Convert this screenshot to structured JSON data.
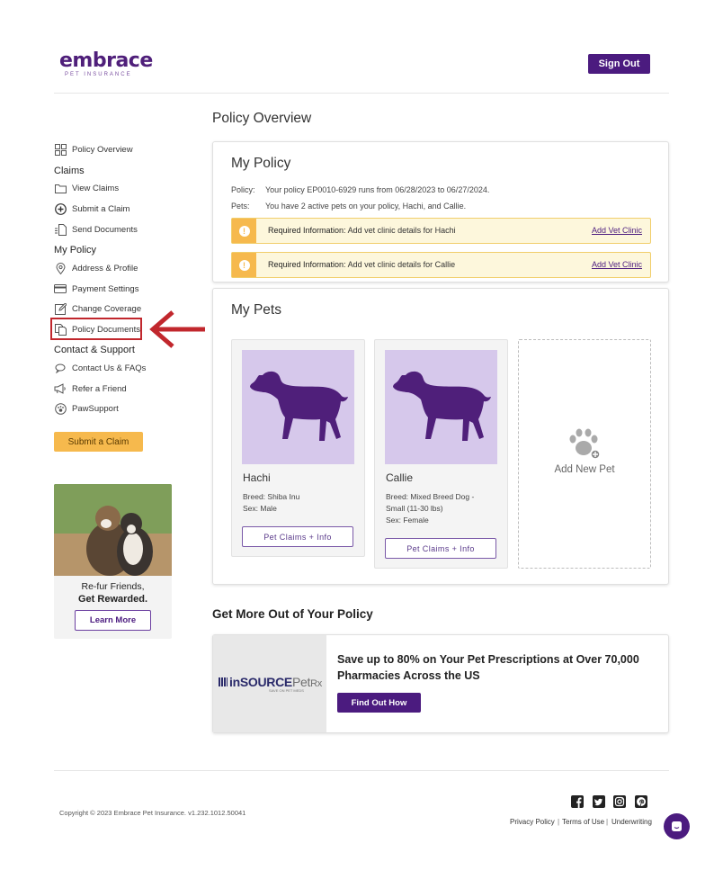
{
  "header": {
    "logo_word": "embrace",
    "logo_sub": "PET INSURANCE",
    "sign_out_label": "Sign Out"
  },
  "sidebar": {
    "overview_label": "Policy Overview",
    "claims_heading": "Claims",
    "claims_items": [
      {
        "label": "View Claims",
        "icon": "folder-icon"
      },
      {
        "label": "Submit a Claim",
        "icon": "plus-circle-icon"
      },
      {
        "label": "Send Documents",
        "icon": "document-upload-icon"
      }
    ],
    "policy_heading": "My Policy",
    "policy_items": [
      {
        "label": "Address & Profile",
        "icon": "location-pin-icon"
      },
      {
        "label": "Payment Settings",
        "icon": "credit-card-icon"
      },
      {
        "label": "Change Coverage",
        "icon": "edit-icon"
      },
      {
        "label": "Policy Documents",
        "icon": "documents-icon"
      }
    ],
    "support_heading": "Contact & Support",
    "support_items": [
      {
        "label": "Contact Us & FAQs",
        "icon": "chat-icon"
      },
      {
        "label": "Refer a Friend",
        "icon": "megaphone-icon"
      },
      {
        "label": "PawSupport",
        "icon": "paw-circle-icon"
      }
    ],
    "submit_claim_label": "Submit a Claim",
    "promo": {
      "line1": "Re-fur Friends,",
      "line2": "Get Rewarded.",
      "button": "Learn More"
    }
  },
  "main": {
    "page_title": "Policy Overview",
    "policy": {
      "title": "My Policy",
      "policy_key": "Policy:",
      "policy_value": "Your policy EP0010-6929 runs from 06/28/2023 to 06/27/2024.",
      "pets_key": "Pets:",
      "pets_value": "You have 2 active pets on your policy, Hachi, and Callie.",
      "alerts": [
        {
          "label": "Required Information:",
          "text": "Add vet clinic details for Hachi",
          "link": "Add Vet Clinic"
        },
        {
          "label": "Required Information:",
          "text": "Add vet clinic details for Callie",
          "link": "Add Vet Clinic"
        }
      ]
    },
    "pets": {
      "title": "My Pets",
      "items": [
        {
          "name": "Hachi",
          "breed": "Breed:  Shiba Inu",
          "sex": "Sex:  Male",
          "button": "Pet Claims + Info"
        },
        {
          "name": "Callie",
          "breed1": "Breed:  Mixed Breed Dog -",
          "breed2": "Small (11-30 lbs)",
          "sex": "Sex:  Female",
          "button": "Pet Claims + Info"
        }
      ],
      "add_new": "Add New Pet"
    },
    "more": {
      "title": "Get More Out of Your Policy",
      "logo_main": "inSOURCE",
      "logo_pet": "Pet",
      "logo_rx": "Rx",
      "logo_sub": "SAVE ON PET MEDS",
      "text": "Save up to 80% on Your Pet Prescriptions at Over 70,000 Pharmacies Across the US",
      "button": "Find Out How"
    }
  },
  "footer": {
    "copyright": "Copyright © 2023   Embrace Pet Insurance. v1.232.1012.50041",
    "links": [
      "Privacy Policy",
      "Terms of Use",
      "Underwriting"
    ],
    "social": [
      "facebook-icon",
      "twitter-icon",
      "instagram-icon",
      "pinterest-icon"
    ]
  },
  "colors": {
    "brand_purple": "#4b1b7f",
    "accent_orange": "#f6b94d",
    "alert_bg": "#fdf7dc",
    "pet_bg": "#d6c8eb",
    "highlight_red": "#c1272d"
  }
}
